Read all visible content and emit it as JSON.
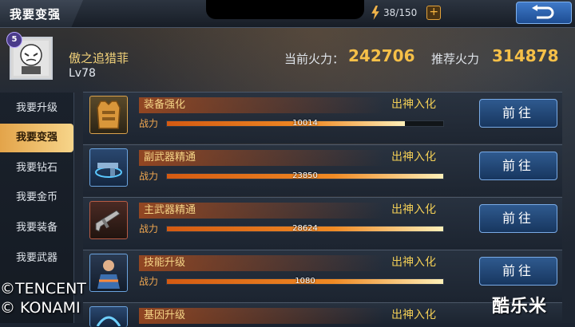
{
  "header": {
    "title": "我要变强",
    "energy": "38/150",
    "plus_label": "+"
  },
  "profile": {
    "level_badge": "5",
    "name": "傲之追猎菲",
    "level": "Lv78",
    "current_power_label": "当前火力：",
    "current_power_value": "242706",
    "recommended_power_label": "推荐火力",
    "recommended_power_value": "314878"
  },
  "sidebar": {
    "items": [
      {
        "label": "我要升级"
      },
      {
        "label": "我要变强"
      },
      {
        "label": "我要钻石"
      },
      {
        "label": "我要金币"
      },
      {
        "label": "我要装备"
      },
      {
        "label": "我要武器"
      }
    ],
    "active_index": 1
  },
  "rows": [
    {
      "title": "装备强化",
      "status": "出神入化",
      "power_label": "战力",
      "power_value": "10014",
      "fill": 0.86,
      "button": "前往",
      "icon": "armor-vest-icon"
    },
    {
      "title": "副武器精通",
      "status": "出神入化",
      "power_label": "战力",
      "power_value": "23850",
      "fill": 1.0,
      "button": "前往",
      "icon": "secondary-weapon-icon"
    },
    {
      "title": "主武器精通",
      "status": "出神入化",
      "power_label": "战力",
      "power_value": "28624",
      "fill": 1.0,
      "button": "前往",
      "icon": "rifle-icon"
    },
    {
      "title": "技能升级",
      "status": "出神入化",
      "power_label": "战力",
      "power_value": "1080",
      "fill": 1.0,
      "button": "前往",
      "icon": "soldier-skill-icon"
    },
    {
      "title": "基因升级",
      "status": "出神入化",
      "power_label": "",
      "power_value": "",
      "fill": 0,
      "button": "",
      "icon": "gene-icon"
    }
  ],
  "watermarks": {
    "left_line1": "©TENCENT",
    "left_line2": "© KONAMI",
    "right": "酷乐米"
  },
  "colors": {
    "accent_gold": "#f6c048",
    "button_blue": "#2f5a8f",
    "bar_orange": "#f08a24"
  }
}
